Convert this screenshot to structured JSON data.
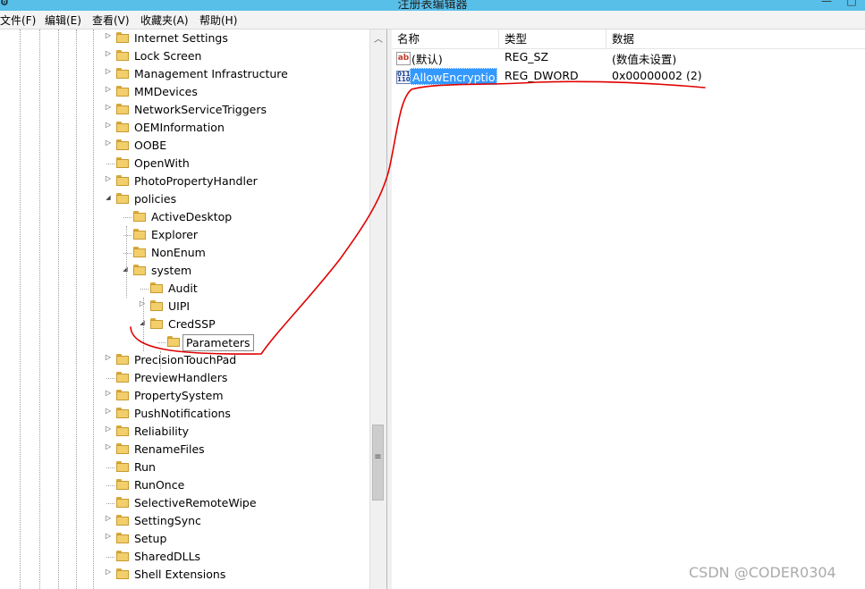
{
  "window": {
    "title": "注册表编辑器",
    "minimize_glyph": "—",
    "maximize_glyph": "□"
  },
  "menu": [
    "文件(F)",
    "编辑(E)",
    "查看(V)",
    "收藏夹(A)",
    "帮助(H)"
  ],
  "tree": {
    "nodes": [
      {
        "label": "Internet Settings",
        "expander": "collapsed"
      },
      {
        "label": "Lock Screen",
        "expander": "collapsed"
      },
      {
        "label": "Management Infrastructure",
        "expander": "collapsed"
      },
      {
        "label": "MMDevices",
        "expander": "collapsed"
      },
      {
        "label": "NetworkServiceTriggers",
        "expander": "collapsed"
      },
      {
        "label": "OEMInformation",
        "expander": "collapsed"
      },
      {
        "label": "OOBE",
        "expander": "collapsed"
      },
      {
        "label": "OpenWith",
        "expander": "none"
      },
      {
        "label": "PhotoPropertyHandler",
        "expander": "collapsed"
      },
      {
        "label": "policies",
        "expander": "expanded"
      },
      {
        "label": "ActiveDesktop",
        "expander": "none"
      },
      {
        "label": "Explorer",
        "expander": "none"
      },
      {
        "label": "NonEnum",
        "expander": "none"
      },
      {
        "label": "system",
        "expander": "expanded"
      },
      {
        "label": "Audit",
        "expander": "none"
      },
      {
        "label": "UIPI",
        "expander": "collapsed"
      },
      {
        "label": "CredSSP",
        "expander": "expanded"
      },
      {
        "label": "Parameters",
        "expander": "none",
        "selected": true
      },
      {
        "label": "PrecisionTouchPad",
        "expander": "collapsed"
      },
      {
        "label": "PreviewHandlers",
        "expander": "none"
      },
      {
        "label": "PropertySystem",
        "expander": "collapsed"
      },
      {
        "label": "PushNotifications",
        "expander": "collapsed"
      },
      {
        "label": "Reliability",
        "expander": "collapsed"
      },
      {
        "label": "RenameFiles",
        "expander": "collapsed"
      },
      {
        "label": "Run",
        "expander": "none"
      },
      {
        "label": "RunOnce",
        "expander": "none"
      },
      {
        "label": "SelectiveRemoteWipe",
        "expander": "none"
      },
      {
        "label": "SettingSync",
        "expander": "collapsed"
      },
      {
        "label": "Setup",
        "expander": "collapsed"
      },
      {
        "label": "SharedDLLs",
        "expander": "none"
      },
      {
        "label": "Shell Extensions",
        "expander": "collapsed"
      }
    ]
  },
  "values_pane": {
    "columns": [
      "名称",
      "类型",
      "数据"
    ],
    "rows": [
      {
        "icon": "string-value-icon",
        "icon_glyph": "ab",
        "name": "(默认)",
        "type": "REG_SZ",
        "data": "(数值未设置)",
        "selected": false
      },
      {
        "icon": "dword-value-icon",
        "icon_glyph": "011\n110",
        "name": "AllowEncryptio...",
        "type": "REG_DWORD",
        "data": "0x00000002 (2)",
        "selected": true
      }
    ]
  },
  "watermark": "CSDN @CODER0304",
  "colors": {
    "titlebar": "#58bfe9",
    "selection": "#3399ff",
    "annotation": "#e00000",
    "folder": "#f2cf6b"
  }
}
